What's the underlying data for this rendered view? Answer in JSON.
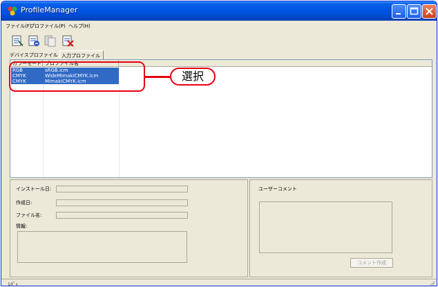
{
  "window": {
    "title": "ProfileManager"
  },
  "menu": {
    "items": [
      "ファイル(F)",
      "プロファイル(P)",
      "ヘルプ(H)"
    ]
  },
  "toolbar": {
    "icons": [
      "install-profile-icon",
      "uninstall-profile-icon",
      "copy-profile-icon",
      "delete-profile-icon"
    ]
  },
  "tabs": [
    {
      "label": "デバイスプロファイル"
    },
    {
      "label": "入力プロファイル"
    }
  ],
  "list": {
    "columns": [
      "カラーモード",
      "プロファイル名"
    ],
    "rows": [
      {
        "mode": "RGB",
        "name": "sRGB.icm"
      },
      {
        "mode": "CMYK",
        "name": "WideMimakiCMYK.icm"
      },
      {
        "mode": "CMYK",
        "name": "MimakiCMYK.icm"
      }
    ]
  },
  "callout": {
    "label": "選択"
  },
  "details": {
    "install_date_label": "インストール日:",
    "created_date_label": "作成日:",
    "file_name_label": "ファイル名:",
    "info_label": "情報:"
  },
  "comment": {
    "label": "ユーザーコメント",
    "button_label": "コメント作成"
  },
  "status": {
    "text": "ﾚﾃﾞｨ"
  },
  "colors": {
    "selection": "#316ac5",
    "callout": "#e60012",
    "titlebar": "#0054e3",
    "window_bg": "#ece9d8"
  }
}
